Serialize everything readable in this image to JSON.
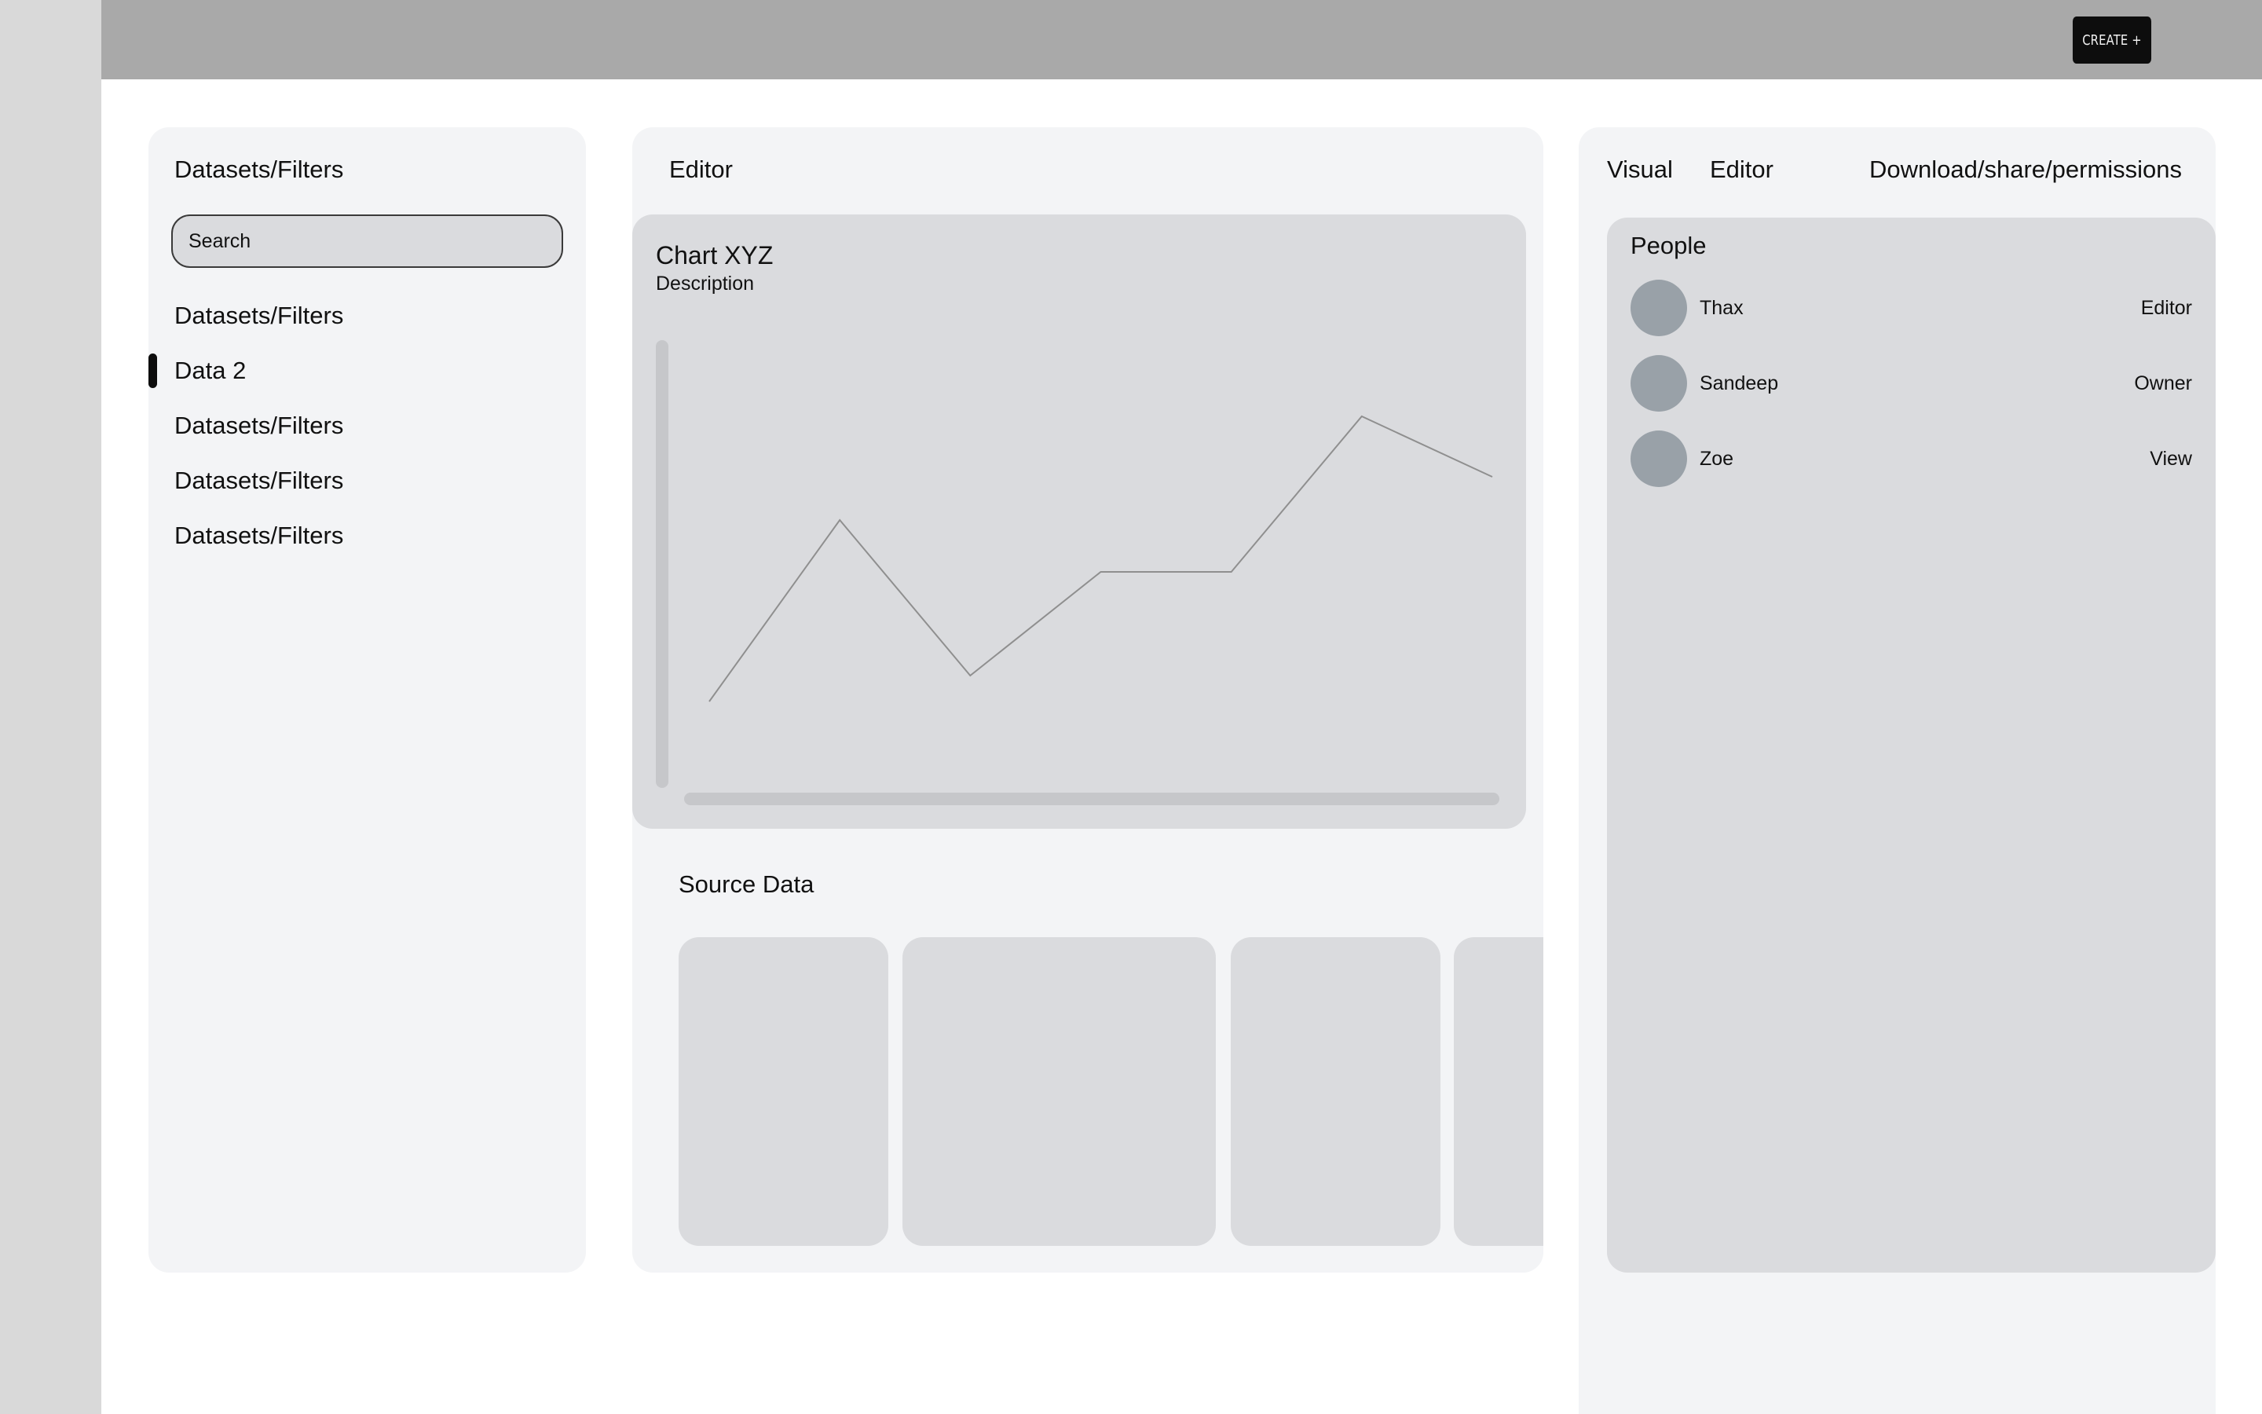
{
  "header": {
    "create_label": "CREATE +"
  },
  "left_panel": {
    "title": "Datasets/Filters",
    "search_placeholder": "Search",
    "items": [
      {
        "label": "Datasets/Filters"
      },
      {
        "label": "Data 2",
        "active": true
      },
      {
        "label": "Datasets/Filters"
      },
      {
        "label": "Datasets/Filters"
      },
      {
        "label": "Datasets/Filters"
      }
    ]
  },
  "editor_panel": {
    "title": "Editor",
    "chart": {
      "title": "Chart XYZ",
      "description": "Description"
    },
    "source_data": {
      "title": "Source Data"
    }
  },
  "chart_data": {
    "type": "line",
    "title": "Chart XYZ",
    "subtitle": "Description",
    "x": [
      0,
      1,
      2,
      3,
      4,
      5,
      6
    ],
    "series": [
      {
        "values": [
          1,
          3.1,
          1.3,
          2.5,
          2.5,
          4.3,
          3.6
        ]
      }
    ],
    "ylim": [
      0,
      5
    ],
    "grid": false
  },
  "right_panel": {
    "tabs": [
      {
        "label": "Visual"
      },
      {
        "label": "Editor"
      },
      {
        "label": "Download/share/permissions"
      }
    ],
    "people": {
      "title": "People",
      "members": [
        {
          "name": "Thax",
          "role": "Editor"
        },
        {
          "name": "Sandeep",
          "role": "Owner"
        },
        {
          "name": "Zoe",
          "role": "View"
        }
      ]
    }
  },
  "colors": {
    "topbar": "#a9a9a9",
    "rail": "#d9d9d9",
    "panel": "#f3f4f6",
    "card": "#dadbde",
    "avatar": "#99a1a8",
    "button": "#0d0d0d"
  }
}
